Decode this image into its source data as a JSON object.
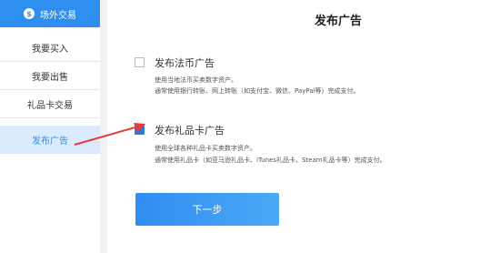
{
  "sidebar": {
    "header_label": "场外交易",
    "items": [
      {
        "label": "我要买入"
      },
      {
        "label": "我要出售"
      },
      {
        "label": "礼品卡交易"
      },
      {
        "label": "发布广告"
      }
    ]
  },
  "main": {
    "title": "发布广告",
    "options": [
      {
        "title": "发布法币广告",
        "desc1": "使用当地法币买卖数字资产。",
        "desc2": "通常使用银行转账、网上转账（如支付宝、微信、PayPal等）完成支付。"
      },
      {
        "title": "发布礼品卡广告",
        "desc1": "使用全球各种礼品卡买卖数字资产。",
        "desc2": "通常使用礼品卡（如亚马逊礼品卡、iTunes礼品卡、Steam礼品卡等）完成支付。"
      }
    ],
    "next_button": "下一步"
  },
  "colors": {
    "accent": "#2e8ff0",
    "active_bg": "#dcebfc",
    "arrow": "#e23b3b"
  },
  "icons": [
    "exchange-logo-icon",
    "checkbox-icon",
    "red-arrow-annotation"
  ]
}
